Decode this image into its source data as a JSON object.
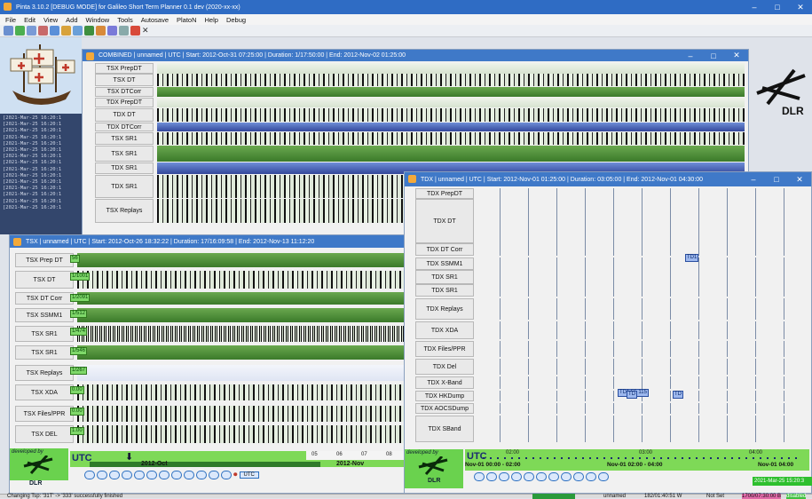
{
  "main": {
    "title": "Pinta 3.10.2 [DEBUG MODE] for Galileo Short Term Planner 0.1 dev (2020-xx-xx)",
    "menu": [
      "File",
      "Edit",
      "View",
      "Add",
      "Window",
      "Tools",
      "Autosave",
      "PlatoN",
      "Help",
      "Debug"
    ]
  },
  "log_lines": [
    "[2021-Mar-25 16:20:1",
    "[2021-Mar-25 16:20:1",
    "[2021-Mar-25 16:20:1",
    "[2021-Mar-25 16:20:1",
    "[2021-Mar-25 16:20:1",
    "[2021-Mar-25 16:20:1",
    "[2021-Mar-25 16:20:1",
    "[2021-Mar-25 16:20:1",
    "[2021-Mar-25 16:20:1",
    "[2021-Mar-25 16:20:1",
    "[2021-Mar-25 16:20:1",
    "[2021-Mar-25 16:20:1",
    "[2021-Mar-25 16:20:1",
    "[2021-Mar-25 16:20:1",
    "[2021-Mar-25 16:20:1"
  ],
  "combined": {
    "title": "COMBINED | unnamed | UTC | Start: 2012-Oct-31 07:25:00 | Duration: 1/17:50:00 | End: 2012-Nov-02 01:25:00",
    "rows": [
      "TSX PrepDT",
      "TSX DT",
      "TSX DTCorr",
      "TDX PrepDT",
      "TDX DT",
      "TDX DTCorr",
      "TSX SR1",
      "TSX SR1",
      "TDX SR1",
      "TDX SR1",
      "TSX Replays"
    ]
  },
  "tsx": {
    "title": "TSX | unnamed | UTC | Start: 2012-Oct-26 18:32:22 | Duration: 17/16:09:58 | End: 2012-Nov-13 11:12:20",
    "rows": [
      "TSX Prep DT",
      "TSX DT",
      "TSX DT Corr",
      "TSX SSMM1",
      "TSX SR1",
      "TSX SR1",
      "TSX Replays",
      "TSX XDA",
      "TSX Files/PPR",
      "TSX DEL"
    ],
    "tags": [
      "56",
      "1/1001",
      "1/2091",
      "1/512",
      "1/474",
      "1/546",
      "1/267",
      "0.00",
      "0.00",
      "1.00"
    ],
    "developed_by": "developed by",
    "dlr": "DLR",
    "utc": "UTC",
    "month_left": "2012-Oct",
    "month_right": "2012-Nov",
    "day_ticks": [
      "05",
      "06",
      "07",
      "08"
    ],
    "utc_btn": "UTC"
  },
  "tdx": {
    "title": "TDX | unnamed | UTC | Start: 2012-Nov-01 01:25:00 | Duration: 03:05:00 | End: 2012-Nov-01 04:30:00",
    "rows": [
      "TDX PrepDT",
      "TDX DT",
      "TDX DT Corr",
      "TDX SSMM1",
      "TDX SR1",
      "TDX SR1",
      "TDX Replays",
      "TDX XDA",
      "TDX Files/PPR",
      "TDX Del",
      "TDX X-Band",
      "TDX HKDump",
      "TDX AOCSDump",
      "TDX SBand"
    ],
    "developed_by": "developed by",
    "dlr": "DLR",
    "utc": "UTC",
    "range_left": "Nov-01 00:00 - 02:00",
    "range_mid": "Nov-01 02:00 - 04:00",
    "range_right": "Nov-01 04:00",
    "hour_ticks": [
      "02:00",
      "03:00",
      "04:00"
    ],
    "box_labels": [
      "TD1 55 115",
      "TD",
      "TD"
    ],
    "vert_label": "TD1"
  },
  "status": {
    "message": "Changing Tsp: '31T' -> '333' successfully finished",
    "unnamed": "unnamed",
    "coord": "182/01:40:51 W",
    "not_set": "Not Set",
    "date1": "1700/07:30:00 B",
    "disabled": "disabled",
    "clock": "2021-Mar-25 15:20:3"
  },
  "colors": {
    "titlebar": "#3f79c8",
    "accent_green": "#7ed957",
    "accent_blue": "#3b5cb8"
  }
}
